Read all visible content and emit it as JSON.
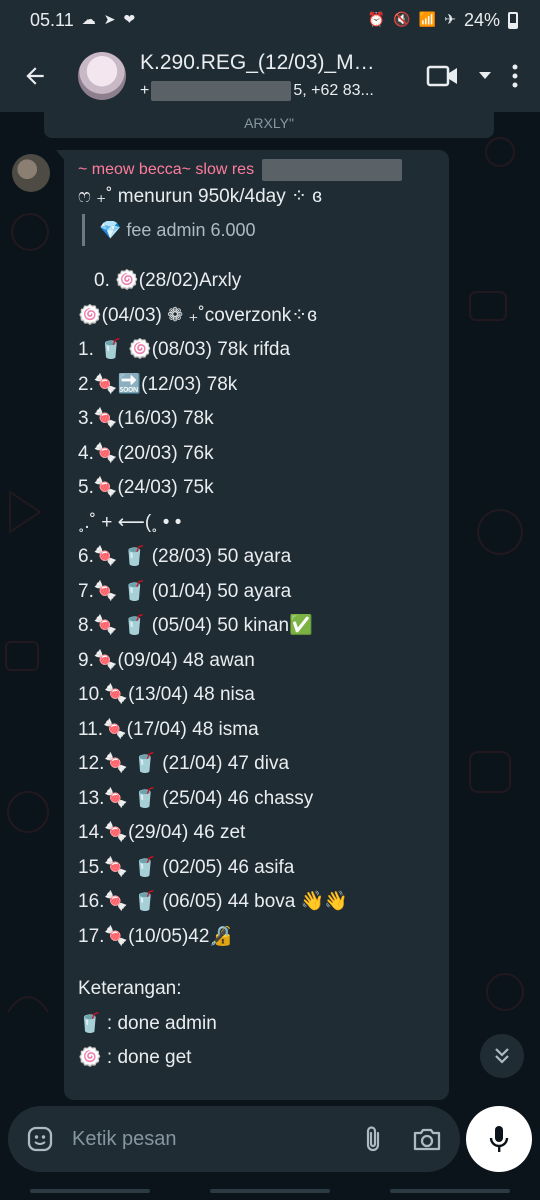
{
  "status_bar": {
    "time": "05.11",
    "battery": "24%",
    "left_icons": [
      "cloud-icon",
      "telegram-icon",
      "heart-app-icon"
    ],
    "right_icons": [
      "alarm-icon",
      "mute-icon",
      "wifi-icon",
      "airplane-icon",
      "battery-icon"
    ]
  },
  "header": {
    "title": "K.290.REG_(12/03)_ME...",
    "subtitle_prefix": "+",
    "subtitle_mid": "5, +62 83...",
    "colors": {
      "bar": "#1f2c34"
    }
  },
  "previous_message": {
    "text": "ARXLY\""
  },
  "message": {
    "sender": "~ meow becca~ slow res",
    "sender_color": "#ff7d9c",
    "lines": [
      "ෆ ₊˚ menurun 950k/4day ⁘ ɞ",
      "0. 🍥(28/02)Arxly",
      "🍥(04/03) ❁ ₊˚coverzonk⁘ɞ",
      "1. 🥤 🍥(08/03) 78k rifda",
      "2.🍬🔜(12/03) 78k",
      "3.🍬(16/03) 78k",
      "4.🍬(20/03) 76k",
      "5.🍬(24/03) 75k",
      "˳.˚ + ⟵(˳ • •",
      "6.🍬 🥤 (28/03) 50 ayara",
      "7.🍬 🥤  (01/04) 50 ayara",
      "8.🍬 🥤 (05/04) 50 kinan✅",
      "9.🍬(09/04) 48 awan",
      "10.🍬(13/04) 48 nisa",
      "11.🍬(17/04) 48 isma",
      "12.🍬 🥤 (21/04) 47 diva",
      "13.🍬 🥤 (25/04) 46 chassy",
      "14.🍬(29/04) 46 zet",
      "15.🍬 🥤 (02/05) 46 asifa",
      "16.🍬 🥤 (06/05) 44 bova 👋👋",
      "17.🍬(10/05)42🔏",
      "Keterangan:",
      "🥤 : done admin",
      "🍥 : done get"
    ],
    "quote": "💎 fee admin 6.000"
  },
  "composer": {
    "placeholder": "Ketik pesan"
  }
}
